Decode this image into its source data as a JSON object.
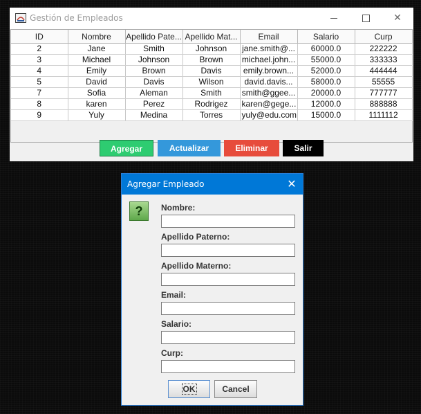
{
  "main_window": {
    "title": "Gestión de Empleados",
    "controls": {
      "minimize": "—",
      "maximize": "☐",
      "close": "✕"
    }
  },
  "table": {
    "columns": [
      "ID",
      "Nombre",
      "Apellido Pate...",
      "Apellido Mat...",
      "Email",
      "Salario",
      "Curp"
    ],
    "rows": [
      [
        "2",
        "Jane",
        "Smith",
        "Johnson",
        "jane.smith@...",
        "60000.0",
        "222222"
      ],
      [
        "3",
        "Michael",
        "Johnson",
        "Brown",
        "michael.john...",
        "55000.0",
        "333333"
      ],
      [
        "4",
        "Emily",
        "Brown",
        "Davis",
        "emily.brown...",
        "52000.0",
        "444444"
      ],
      [
        "5",
        "David",
        "Davis",
        "Wilson",
        "david.davis...",
        "58000.0",
        "55555"
      ],
      [
        "7",
        "Sofia",
        "Aleman",
        "Smith",
        "smith@ggee...",
        "20000.0",
        "777777"
      ],
      [
        "8",
        "karen",
        "Perez",
        "Rodrigez",
        "karen@gege...",
        "12000.0",
        "888888"
      ],
      [
        "9",
        "Yuly",
        "Medina",
        "Torres",
        "yuly@edu.com",
        "15000.0",
        "1111112"
      ]
    ]
  },
  "actions": {
    "add": {
      "label": "Agregar",
      "color": "#2ecc71"
    },
    "update": {
      "label": "Actualizar",
      "color": "#3498db"
    },
    "delete": {
      "label": "Eliminar",
      "color": "#e74c3c"
    },
    "exit": {
      "label": "Salir",
      "color": "#000000"
    }
  },
  "dialog": {
    "title": "Agregar Empleado",
    "icon": "question-icon",
    "icon_glyph": "?",
    "close_glyph": "✕",
    "fields": [
      {
        "label": "Nombre:",
        "value": ""
      },
      {
        "label": "Apellido Paterno:",
        "value": ""
      },
      {
        "label": "Apellido Materno:",
        "value": ""
      },
      {
        "label": "Email:",
        "value": ""
      },
      {
        "label": "Salario:",
        "value": ""
      },
      {
        "label": "Curp:",
        "value": ""
      }
    ],
    "ok_label": "OK",
    "cancel_label": "Cancel"
  }
}
